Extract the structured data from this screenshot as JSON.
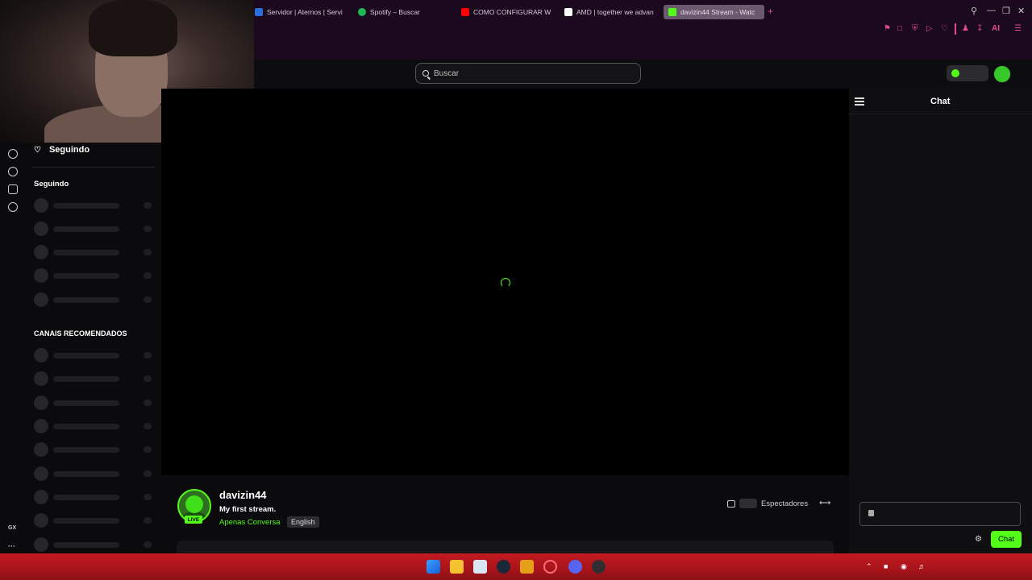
{
  "browser": {
    "tabs": [
      {
        "label": "Servidor | Aternos | Servi",
        "favicon_color": "#2a6fdb"
      },
      {
        "label": "Spotify – Buscar",
        "favicon_color": "#1db954"
      },
      {
        "label": "COMO CONFIGURAR WE",
        "favicon_color": "#ff0000"
      },
      {
        "label": "AMD | together we advan",
        "favicon_color": "#ffffff"
      },
      {
        "label": "davizin44 Stream - Watc",
        "favicon_color": "#53fc18",
        "active": true
      }
    ],
    "new_tab": "+",
    "ai_label": "AI"
  },
  "header": {
    "search_placeholder": "Buscar"
  },
  "left_rail": {
    "gx_label": "GX",
    "more_label": "···"
  },
  "sidebar": {
    "following_header": "Seguindo",
    "following_title": "Seguindo",
    "recommended_title": "CANAIS RECOMENDADOS",
    "following_skeleton_rows": 5,
    "recommended_skeleton_rows": 9
  },
  "chat": {
    "title": "Chat",
    "send_label": "Chat"
  },
  "stream": {
    "channel": "davizin44",
    "title": "My first stream.",
    "category": "Apenas Conversa",
    "language": "English",
    "live_badge": "LIVE",
    "viewers_label": "Espectadores"
  },
  "colors": {
    "accent": "#53fc18",
    "browser_chrome": "#1b0a1d",
    "opera_accent": "#e24b8b",
    "taskbar": "#b5161c"
  }
}
